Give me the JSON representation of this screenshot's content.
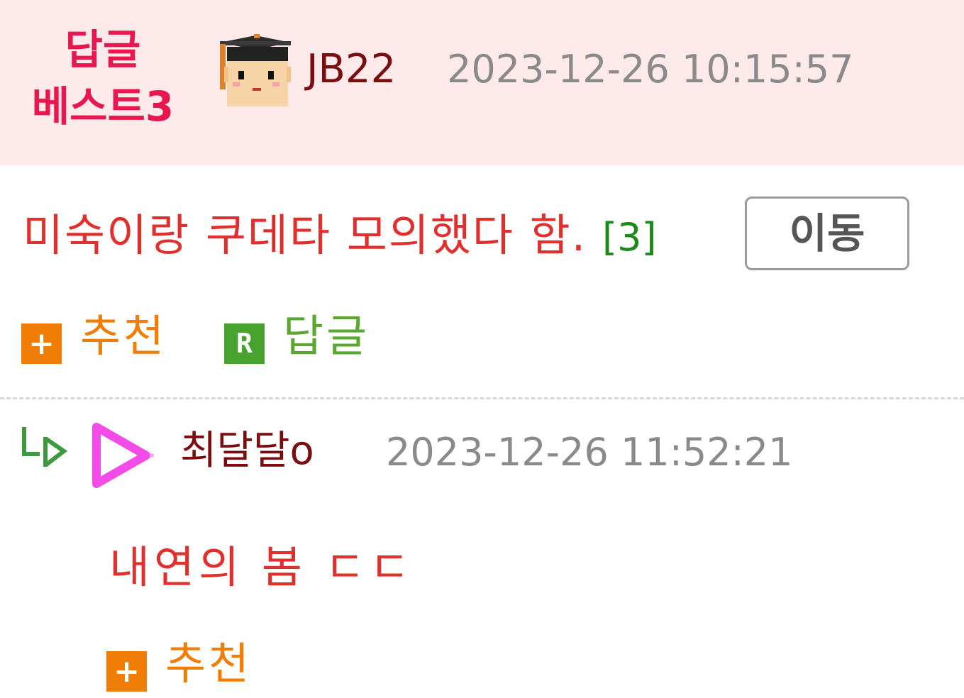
{
  "header": {
    "badge_line1": "답글",
    "badge_line2": "베스트3",
    "username": "JB22",
    "timestamp": "2023-12-26 10:15:57",
    "avatar_icon": "graduate-avatar-icon"
  },
  "post": {
    "title": "미숙이랑 쿠데타 모의했다 함.",
    "reply_count": "[3]",
    "move_button_label": "이동"
  },
  "actions": {
    "recommend_icon_glyph": "+",
    "recommend_label": "추천",
    "reply_icon_glyph": "R",
    "reply_label": "답글"
  },
  "reply": {
    "arrow_icon": "reply-arrow-icon",
    "avatar_icon": "pink-play-icon",
    "username": "최달달o",
    "timestamp": "2023-12-26 11:52:21",
    "text": "내연의 봄 ㄷㄷ",
    "recommend_icon_glyph": "+",
    "recommend_label": "추천"
  },
  "colors": {
    "header_bg": "#feeaea",
    "badge": "#e8174f",
    "username": "#7a0e0e",
    "timestamp": "#8a8a8a",
    "title": "#e0302e",
    "reply_count": "#1a8a1a",
    "recommend": "#ef7d06",
    "reply": "#5aa832"
  }
}
